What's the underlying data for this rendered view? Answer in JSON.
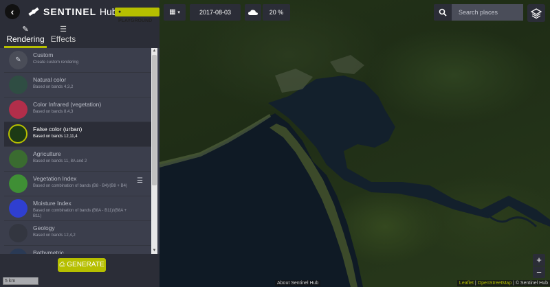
{
  "header": {
    "brand_name": "SENTINEL",
    "brand_sub": "Hub",
    "badge": "PLAYGROUND"
  },
  "tabs": [
    {
      "label": "Rendering",
      "icon": "brush-icon",
      "active": true
    },
    {
      "label": "Effects",
      "icon": "sliders-icon",
      "active": false
    }
  ],
  "layers": [
    {
      "name": "Custom",
      "desc": "Create custom rendering",
      "thumb": "#4a4d58"
    },
    {
      "name": "Natural color",
      "desc": "Based on bands 4,3,2",
      "thumb": "#2f4d43"
    },
    {
      "name": "Color Infrared (vegetation)",
      "desc": "Based on bands 8,4,3",
      "thumb": "#b22e4a"
    },
    {
      "name": "False color (urban)",
      "desc": "Based on bands 12,11,4",
      "thumb": "#1c3a15",
      "active": true
    },
    {
      "name": "Agriculture",
      "desc": "Based on bands 11, 8A and 2",
      "thumb": "#3a6b30"
    },
    {
      "name": "Vegetation Index",
      "desc": "Based on combination of bands (B8 - B4)/(B8 + B4)",
      "thumb": "#3f8f35",
      "has_legend": true
    },
    {
      "name": "Moisture Index",
      "desc": "Based on combination of bands (B8A - B11)/(B8A + B11)",
      "thumb": "#2f3fd0"
    },
    {
      "name": "Geology",
      "desc": "Based on bands 12,4,2",
      "thumb": "#333640"
    },
    {
      "name": "Bathymetric",
      "desc": "",
      "thumb": "#2a3a55"
    }
  ],
  "generate_label": "GENERATE",
  "date": "2017-08-03",
  "cloud_coverage": "20 %",
  "search": {
    "placeholder": "Search places"
  },
  "scale_label": "5 km",
  "zoom": {
    "in": "+",
    "out": "−"
  },
  "about": "About Sentinel Hub",
  "attribution": {
    "leaflet": "Leaflet",
    "osm": "OpenStreetMap",
    "hub": "© Sentinel Hub",
    "sep": " | "
  },
  "colors": {
    "accent": "#b6bf00",
    "panel": "#3b3e4c",
    "panel_dark": "#2b2d37"
  }
}
